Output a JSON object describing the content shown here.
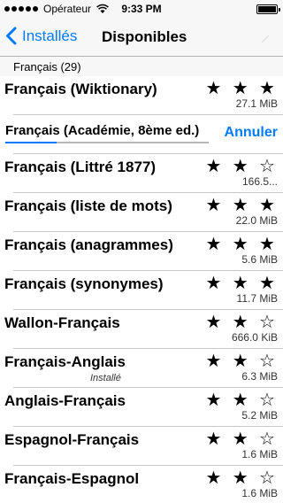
{
  "status_bar": {
    "carrier": "Opérateur",
    "time": "9:33 PM"
  },
  "nav": {
    "back_label": "Installés",
    "title": "Disponibles"
  },
  "section": {
    "header": "Français (29)"
  },
  "downloading": {
    "name": "Français (Académie, 8ème ed.)",
    "cancel_label": "Annuler",
    "progress": 0.25
  },
  "rows": [
    {
      "name": "Français (Wiktionary)",
      "stars": "★ ★ ★",
      "size": "27.1 MiB",
      "installed": ""
    },
    {
      "name": "Français (Littré 1877)",
      "stars": "★ ★ ☆",
      "size": "166.5...",
      "installed": ""
    },
    {
      "name": "Français (liste de mots)",
      "stars": "★ ★ ★",
      "size": "22.0 MiB",
      "installed": ""
    },
    {
      "name": "Français (anagrammes)",
      "stars": "★ ★ ★",
      "size": "5.6 MiB",
      "installed": ""
    },
    {
      "name": "Français (synonymes)",
      "stars": "★ ★ ★",
      "size": "11.7 MiB",
      "installed": ""
    },
    {
      "name": "Wallon-Français",
      "stars": "★ ★ ☆",
      "size": "666.0 KiB",
      "installed": ""
    },
    {
      "name": "Français-Anglais",
      "stars": "★ ★ ☆",
      "size": "6.3 MiB",
      "installed": "Installé"
    },
    {
      "name": "Anglais-Français",
      "stars": "★ ★ ☆",
      "size": "5.2 MiB",
      "installed": ""
    },
    {
      "name": "Espagnol-Français",
      "stars": "★ ★ ☆",
      "size": "1.6 MiB",
      "installed": ""
    },
    {
      "name": "Français-Espagnol",
      "stars": "★ ★ ☆",
      "size": "1.6 MiB",
      "installed": ""
    }
  ],
  "colors": {
    "accent": "#007aff",
    "separator": "#c8c7cc",
    "bar_bg": "#f7f7f7"
  }
}
